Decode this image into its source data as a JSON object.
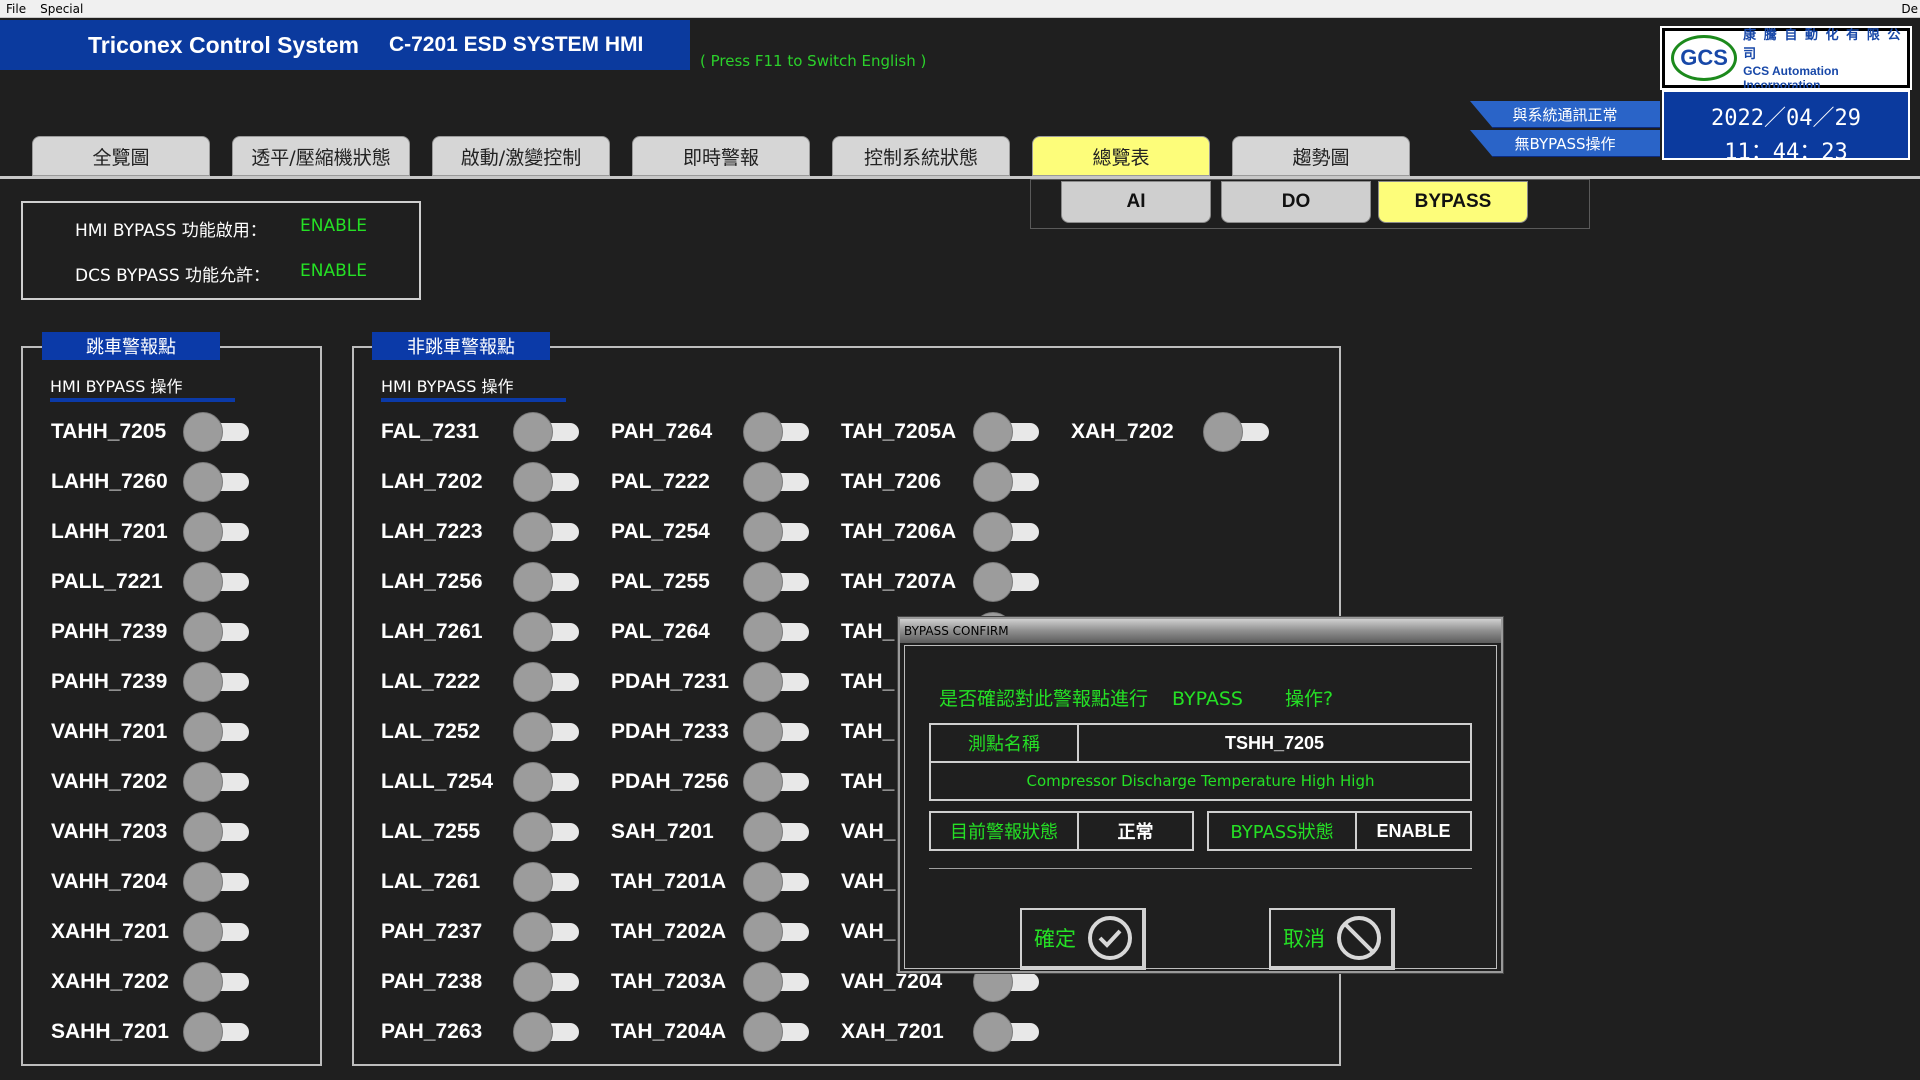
{
  "menubar": {
    "file": "File",
    "special": "Special",
    "right": "De"
  },
  "title": {
    "system": "Triconex Control System",
    "hmi": "C-7201 ESD SYSTEM HMI"
  },
  "hint": "( Press F11 to Switch English )",
  "logo": {
    "mark": "GCS",
    "cn": "康 騰 自 動 化 有 限 公 司",
    "en": "GCS Automation Incorporation"
  },
  "clock": {
    "date": "2022／04／29",
    "time": "11：44：23"
  },
  "status_flags": [
    "與系統通訊正常",
    "無BYPASS操作"
  ],
  "tabs": [
    "全覽圖",
    "透平/壓縮機狀態",
    "啟動/激變控制",
    "即時警報",
    "控制系統狀態",
    "總覽表",
    "趨勢圖"
  ],
  "active_tab": "總覽表",
  "subtabs": [
    "AI",
    "DO",
    "BYPASS"
  ],
  "active_subtab": "BYPASS",
  "enable_box": {
    "hmi_label": "HMI BYPASS 功能啟用：",
    "hmi_value": "ENABLE",
    "dcs_label": "DCS BYPASS 功能允許：",
    "dcs_value": "ENABLE"
  },
  "trip_panel": {
    "tag": "跳車警報點",
    "sub": "HMI BYPASS 操作",
    "items": [
      "TAHH_7205",
      "LAHH_7260",
      "LAHH_7201",
      "PALL_7221",
      "PAHH_7239",
      "PAHH_7239",
      "VAHH_7201",
      "VAHH_7202",
      "VAHH_7203",
      "VAHH_7204",
      "XAHH_7201",
      "XAHH_7202",
      "SAHH_7201"
    ]
  },
  "nontrip_panel": {
    "tag": "非跳車警報點",
    "sub": "HMI BYPASS 操作",
    "col1": [
      "FAL_7231",
      "LAH_7202",
      "LAH_7223",
      "LAH_7256",
      "LAH_7261",
      "LAL_7222",
      "LAL_7252",
      "LALL_7254",
      "LAL_7255",
      "LAL_7261",
      "PAH_7237",
      "PAH_7238",
      "PAH_7263"
    ],
    "col2": [
      "PAH_7264",
      "PAL_7222",
      "PAL_7254",
      "PAL_7255",
      "PAL_7264",
      "PDAH_7231",
      "PDAH_7233",
      "PDAH_7256",
      "SAH_7201",
      "TAH_7201A",
      "TAH_7202A",
      "TAH_7203A",
      "TAH_7204A"
    ],
    "col3": [
      "TAH_7205A",
      "TAH_7206",
      "TAH_7206A",
      "TAH_7207A",
      "TAH_",
      "TAH_",
      "TAH_",
      "TAH_",
      "VAH_",
      "VAH_",
      "VAH_",
      "VAH_7204",
      "XAH_7201"
    ],
    "col4": [
      "XAH_7202"
    ]
  },
  "dialog": {
    "title": "BYPASS CONFIRM",
    "question_a": "是否確認對此警報點進行",
    "question_bp": "BYPASS",
    "question_b": "操作?",
    "point_label": "測點名稱",
    "point_value": "TSHH_7205",
    "description": "Compressor Discharge Temperature High High",
    "alarm_label": "目前警報狀態",
    "alarm_value": "正常",
    "bypass_label": "BYPASS狀態",
    "bypass_value": "ENABLE",
    "ok": "確定",
    "cancel": "取消"
  }
}
